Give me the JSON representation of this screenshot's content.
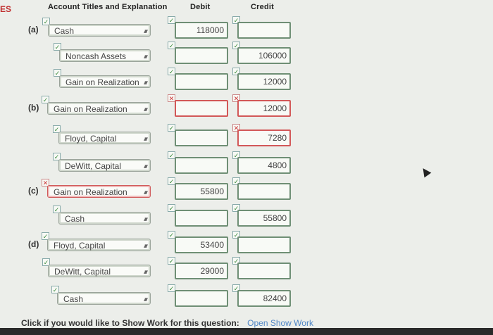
{
  "side_tag": "ES",
  "headers": {
    "account": "Account Titles and Explanation",
    "debit": "Debit",
    "credit": "Credit"
  },
  "rows": [
    {
      "part": "(a)",
      "account": "Cash",
      "debit": "118000",
      "credit": "",
      "acct_ok": true,
      "debit_ok": true,
      "credit_ok": true
    },
    {
      "part": "",
      "account": "Noncash Assets",
      "debit": "",
      "credit": "106000",
      "acct_ok": true,
      "debit_ok": true,
      "credit_ok": true
    },
    {
      "part": "",
      "account": "Gain on Realization",
      "debit": "",
      "credit": "12000",
      "acct_ok": true,
      "debit_ok": true,
      "credit_ok": true
    },
    {
      "part": "(b)",
      "account": "Gain on Realization",
      "debit": "",
      "credit": "12000",
      "acct_ok": true,
      "debit_ok": false,
      "credit_ok": false
    },
    {
      "part": "",
      "account": "Floyd, Capital",
      "debit": "",
      "credit": "7280",
      "acct_ok": true,
      "debit_ok": true,
      "credit_ok": false
    },
    {
      "part": "",
      "account": "DeWitt, Capital",
      "debit": "",
      "credit": "4800",
      "acct_ok": true,
      "debit_ok": true,
      "credit_ok": true
    },
    {
      "part": "(c)",
      "account": "Gain on Realization",
      "debit": "55800",
      "credit": "",
      "acct_ok": false,
      "debit_ok": true,
      "credit_ok": true
    },
    {
      "part": "",
      "account": "Cash",
      "debit": "",
      "credit": "55800",
      "acct_ok": true,
      "debit_ok": true,
      "credit_ok": true
    },
    {
      "part": "(d)",
      "account": "Floyd, Capital",
      "debit": "53400",
      "credit": "",
      "acct_ok": true,
      "debit_ok": true,
      "credit_ok": true
    },
    {
      "part": "",
      "account": "DeWitt, Capital",
      "debit": "29000",
      "credit": "",
      "acct_ok": true,
      "debit_ok": true,
      "credit_ok": true
    },
    {
      "part": "",
      "account": "Cash",
      "debit": "",
      "credit": "82400",
      "acct_ok": true,
      "debit_ok": true,
      "credit_ok": true
    }
  ],
  "footer": {
    "prompt": "Click if you would like to Show Work for this question:",
    "link": "Open Show Work"
  },
  "icons": {
    "correct": "check-icon",
    "incorrect": "x-icon",
    "select": "updown-arrow-icon"
  }
}
